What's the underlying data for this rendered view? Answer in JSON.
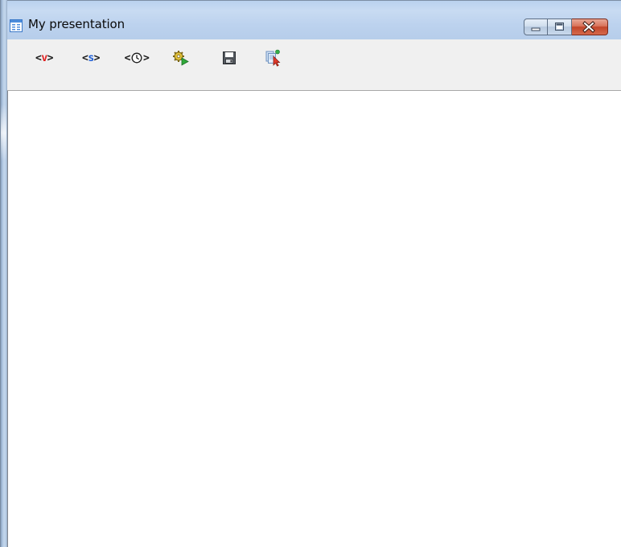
{
  "window": {
    "title": "My presentation",
    "icon": "presentation-window-icon"
  },
  "caption_buttons": {
    "minimize_icon": "minimize-icon",
    "maximize_icon": "maximize-icon",
    "close_icon": "close-icon"
  },
  "toolbar": {
    "view_button": {
      "left": "<",
      "middle": "v",
      "right": ">",
      "icon": "view-tag-icon",
      "accent": "#e02020"
    },
    "source_button": {
      "left": "<",
      "middle": "s",
      "right": ">",
      "icon": "source-tag-icon",
      "accent": "#1f5fd6"
    },
    "timer_button": {
      "left": "<",
      "right": ">",
      "icon": "clock-icon"
    },
    "run_button": {
      "icon": "gear-run-icon"
    },
    "save_button": {
      "icon": "floppy-disk-icon"
    },
    "select_button": {
      "icon": "select-pointer-icon"
    }
  },
  "colors": {
    "titlebar": "#c3d7f0",
    "toolbar_bg": "#f0f0f0",
    "content_bg": "#ffffff",
    "close_button": "#c94a30"
  }
}
